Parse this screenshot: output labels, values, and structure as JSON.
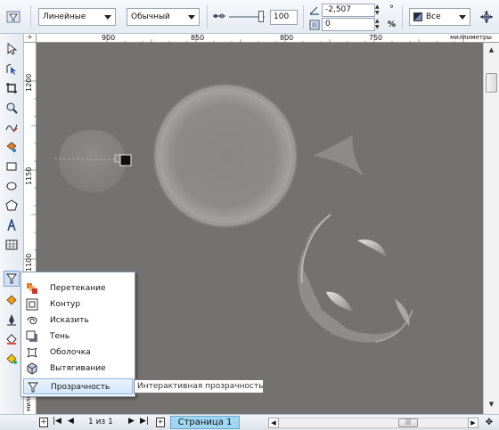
{
  "toolbar": {
    "line_style_value": "Линейные",
    "blend_mode_value": "Обычный",
    "transparency_value": "100",
    "angle_value": "-2,507",
    "edge_value": "0",
    "deg_symbol": "°",
    "pct_symbol": "%",
    "apply_to_value": "Все"
  },
  "ruler_h": {
    "ticks": [
      "900",
      "850",
      "800",
      "750"
    ],
    "unit": "миллиметры"
  },
  "ruler_v": {
    "ticks": [
      "1200",
      "1150",
      "1100"
    ],
    "unit": "миллим"
  },
  "flyout": {
    "items": [
      {
        "label": "Перетекание",
        "icon": "blend-icon"
      },
      {
        "label": "Контур",
        "icon": "contour-icon"
      },
      {
        "label": "Исказить",
        "icon": "distort-icon"
      },
      {
        "label": "Тень",
        "icon": "drop-shadow-icon"
      },
      {
        "label": "Оболочка",
        "icon": "envelope-icon"
      },
      {
        "label": "Вытягивание",
        "icon": "extrude-icon"
      },
      {
        "label": "Прозрачность",
        "icon": "transparency-icon"
      }
    ]
  },
  "tooltip": "Интерактивная прозрачность",
  "status": {
    "page_counter": "1 из 1",
    "page_tab": "Страница 1"
  },
  "colors": {
    "canvas": "#737271",
    "toolbar_bg": "#e6ebf2",
    "selection": "#d5e7fb",
    "page_tab": "#9fd7f2"
  }
}
